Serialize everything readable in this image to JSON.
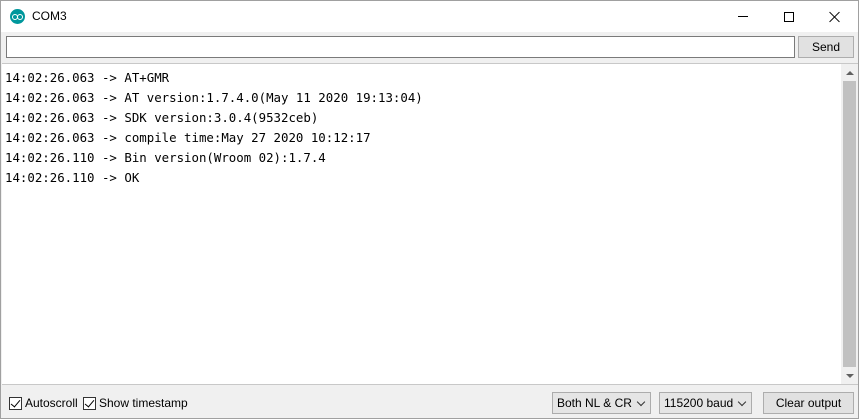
{
  "window": {
    "title": "COM3",
    "app_icon": "arduino-icon",
    "controls": [
      "minimize-icon",
      "maximize-icon",
      "close-icon"
    ]
  },
  "input": {
    "value": "",
    "placeholder": ""
  },
  "toolbar": {
    "send_label": "Send"
  },
  "output": {
    "lines": [
      "14:02:26.063 -> AT+GMR",
      "14:02:26.063 -> AT version:1.7.4.0(May 11 2020 19:13:04)",
      "14:02:26.063 -> SDK version:3.0.4(9532ceb)",
      "14:02:26.063 -> compile time:May 27 2020 10:12:17",
      "14:02:26.110 -> Bin version(Wroom 02):1.7.4",
      "14:02:26.110 -> OK"
    ]
  },
  "footer": {
    "autoscroll_label": "Autoscroll",
    "autoscroll_checked": true,
    "timestamp_label": "Show timestamp",
    "timestamp_checked": true,
    "line_ending": "Both NL & CR",
    "baud_rate": "115200 baud",
    "clear_label": "Clear output"
  },
  "colors": {
    "accent": "#00979c",
    "window_bg": "#f0f0f0",
    "output_bg": "#ffffff"
  }
}
